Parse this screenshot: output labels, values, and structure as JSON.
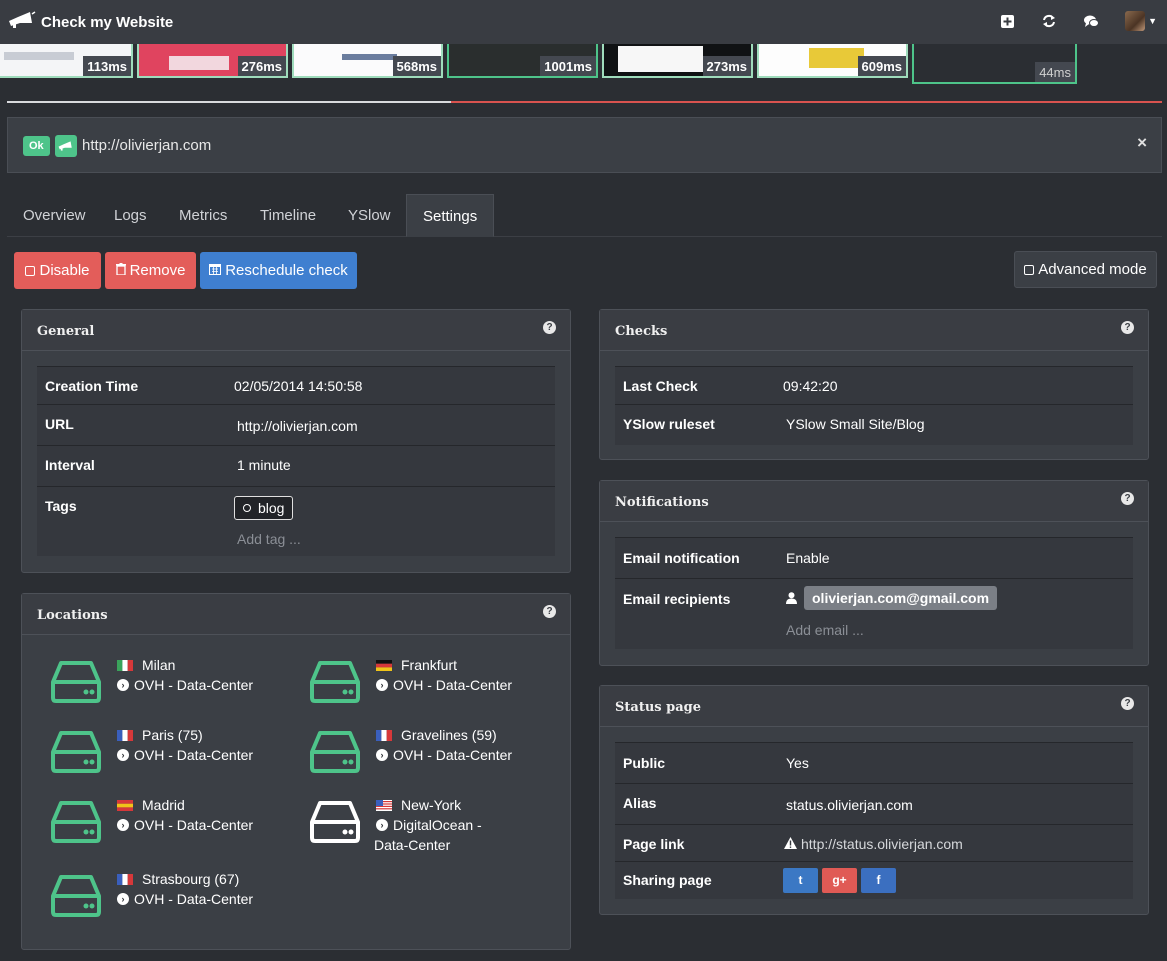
{
  "app": {
    "title": "Check my Website"
  },
  "thumbnails": [
    {
      "time": "113ms"
    },
    {
      "time": "276ms"
    },
    {
      "time": "568ms"
    },
    {
      "time": "1001ms"
    },
    {
      "time": "273ms"
    },
    {
      "time": "609ms"
    },
    {
      "time": "44ms"
    }
  ],
  "check": {
    "status": "Ok",
    "url": "http://olivierjan.com",
    "close": "×"
  },
  "tabs": [
    "Overview",
    "Logs",
    "Metrics",
    "Timeline",
    "YSlow",
    "Settings"
  ],
  "actions": {
    "disable": "Disable",
    "remove": "Remove",
    "reschedule": "Reschedule check",
    "advanced": "Advanced mode"
  },
  "general": {
    "title": "General",
    "creation_label": "Creation Time",
    "creation_value": "02/05/2014 14:50:58",
    "url_label": "URL",
    "url_value": "http://olivierjan.com",
    "interval_label": "Interval",
    "interval_value": "1 minute",
    "tags_label": "Tags",
    "tag": "blog",
    "tag_placeholder": "Add tag ..."
  },
  "checks": {
    "title": "Checks",
    "last_label": "Last Check",
    "last_value": "09:42:20",
    "ruleset_label": "YSlow ruleset",
    "ruleset_value": "YSlow Small Site/Blog"
  },
  "notifications": {
    "title": "Notifications",
    "email_label": "Email notification",
    "email_value": "Enable",
    "recipients_label": "Email recipients",
    "recipient": "olivierjan.com@gmail.com",
    "email_placeholder": "Add email ..."
  },
  "status_page": {
    "title": "Status page",
    "public_label": "Public",
    "public_value": "Yes",
    "alias_label": "Alias",
    "alias_value": "status.olivierjan.com",
    "link_label": "Page link",
    "link_value": "http://status.olivierjan.com",
    "sharing_label": "Sharing page",
    "share_twitter": "t",
    "share_gplus": "g+",
    "share_facebook": "f"
  },
  "locations": {
    "title": "Locations",
    "items": [
      {
        "name": "Milan",
        "provider": "OVH - Data-Center",
        "flag": "it",
        "color": "#4ec48a"
      },
      {
        "name": "Frankfurt",
        "provider": "OVH - Data-Center",
        "flag": "de",
        "color": "#4ec48a"
      },
      {
        "name": "Paris (75)",
        "provider": "OVH - Data-Center",
        "flag": "fr",
        "color": "#4ec48a"
      },
      {
        "name": "Gravelines (59)",
        "provider": "OVH - Data-Center",
        "flag": "fr",
        "color": "#4ec48a"
      },
      {
        "name": "Madrid",
        "provider": "OVH - Data-Center",
        "flag": "es",
        "color": "#4ec48a"
      },
      {
        "name": "New-York",
        "provider": "DigitalOcean -",
        "provider2": "Data-Center",
        "flag": "us",
        "color": "#ffffff"
      },
      {
        "name": "Strasbourg (67)",
        "provider": "OVH - Data-Center",
        "flag": "fr",
        "color": "#4ec48a"
      }
    ]
  }
}
